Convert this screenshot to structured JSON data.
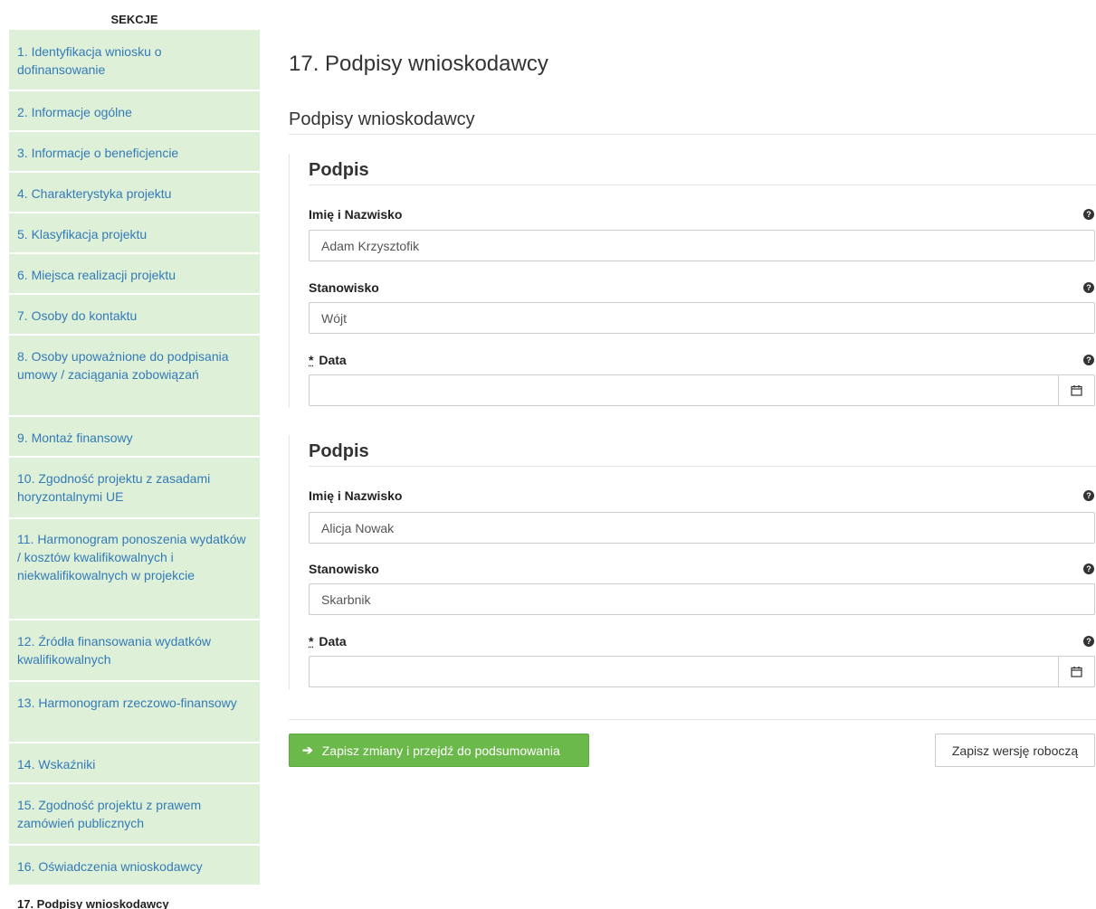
{
  "sidebar": {
    "title": "SEKCJE",
    "items": [
      {
        "label": "1. Identyfikacja wniosku o dofinansowanie"
      },
      {
        "label": "2. Informacje ogólne"
      },
      {
        "label": "3. Informacje o beneficjencie"
      },
      {
        "label": "4. Charakterystyka projektu"
      },
      {
        "label": "5. Klasyfikacja projektu"
      },
      {
        "label": "6. Miejsca realizacji projektu"
      },
      {
        "label": "7. Osoby do kontaktu"
      },
      {
        "label": "8. Osoby upoważnione do podpisania umowy / zaciągania zobowiązań"
      },
      {
        "label": "9. Montaż finansowy"
      },
      {
        "label": "10. Zgodność projektu z zasadami horyzontalnymi UE"
      },
      {
        "label": "11. Harmonogram ponoszenia wydatków / kosztów kwalifikowalnych i niekwalifikowalnych w projekcie"
      },
      {
        "label": "12. Źródła finansowania wydatków kwalifikowalnych"
      },
      {
        "label": "13. Harmonogram rzeczowo-finansowy"
      },
      {
        "label": "14. Wskaźniki"
      },
      {
        "label": "15. Zgodność projektu z prawem zamówień publicznych"
      },
      {
        "label": "16. Oświadczenia wnioskodawcy"
      },
      {
        "label": "17. Podpisy wnioskodawcy"
      }
    ]
  },
  "main": {
    "page_title": "17. Podpisy wnioskodawcy",
    "section_title": "Podpisy wnioskodawcy",
    "signatures": [
      {
        "title": "Podpis",
        "name_label": "Imię i Nazwisko",
        "name_value": "Adam Krzysztofik",
        "position_label": "Stanowisko",
        "position_value": "Wójt",
        "date_required_mark": "*",
        "date_label": "Data",
        "date_value": ""
      },
      {
        "title": "Podpis",
        "name_label": "Imię i Nazwisko",
        "name_value": "Alicja Nowak",
        "position_label": "Stanowisko",
        "position_value": "Skarbnik",
        "date_required_mark": "*",
        "date_label": "Data",
        "date_value": ""
      }
    ],
    "help_icon": "question-circle-icon",
    "calendar_icon": "calendar-icon",
    "save_and_continue_label": "Zapisz zmiany i przejdź do podsumowania",
    "save_draft_label": "Zapisz wersję roboczą"
  },
  "colors": {
    "sidebar_bg": "#dff0d8",
    "link": "#337ab7",
    "primary_button": "#6cb94b"
  }
}
